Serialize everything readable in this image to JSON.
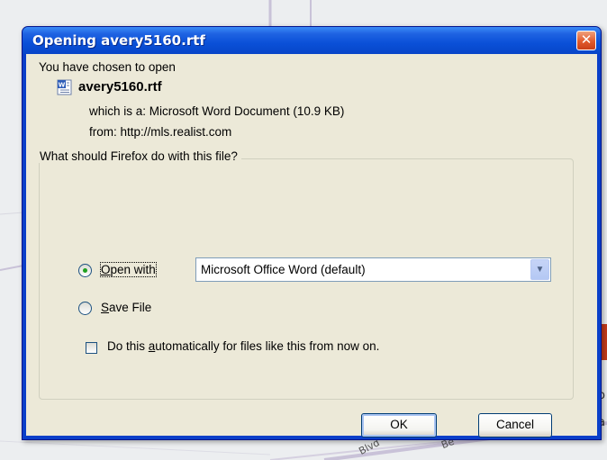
{
  "window": {
    "title": "Opening avery5160.rtf",
    "close_icon": "close-x-icon"
  },
  "file_info": {
    "intro": "You have chosen to open",
    "file_icon": "word-document-icon",
    "file_name": "avery5160.rtf",
    "which_is": "which is a:  Microsoft Word Document (10.9 KB)",
    "from": "from:  http://mls.realist.com"
  },
  "action": {
    "question": "What should Firefox do with this file?",
    "open_with_label": "Open with",
    "open_with_app": "Microsoft Office Word (default)",
    "save_file_label": "Save File",
    "selected": "open_with",
    "auto_label": "Do this automatically for files like this from now on.",
    "auto_checked": false
  },
  "buttons": {
    "ok": "OK",
    "cancel": "Cancel"
  },
  "background_map": {
    "labels": [
      "Blvd",
      "Be",
      "o",
      "a"
    ]
  }
}
